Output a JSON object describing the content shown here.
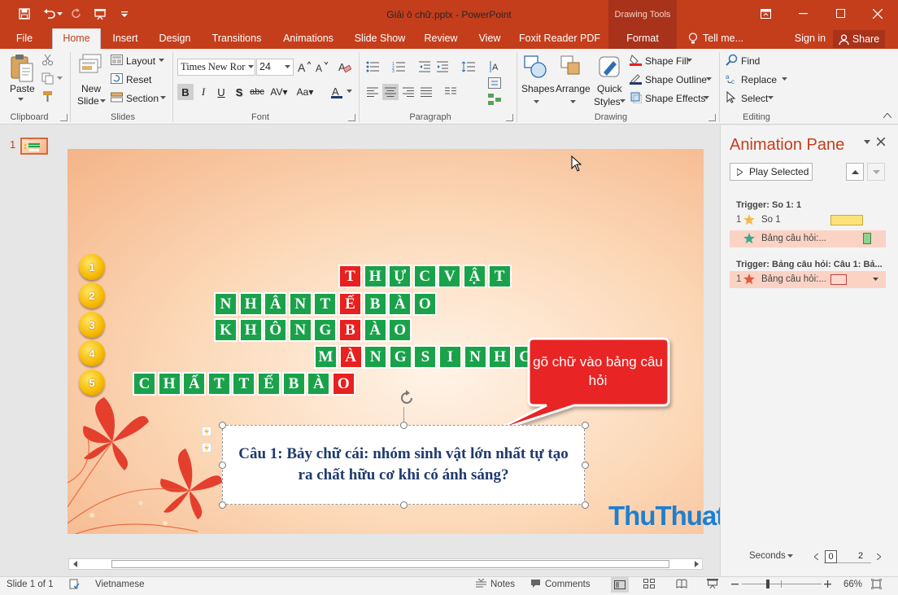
{
  "window": {
    "title": "Giải ô chữ.pptx - PowerPoint",
    "contextual_group": "Drawing Tools",
    "accent_color": "#c43e1c"
  },
  "tabs": [
    "File",
    "Home",
    "Insert",
    "Design",
    "Transitions",
    "Animations",
    "Slide Show",
    "Review",
    "View",
    "Foxit Reader PDF",
    "Format"
  ],
  "tell_me": "Tell me...",
  "sign_in": "Sign in",
  "share": "Share",
  "ribbon": {
    "clipboard": {
      "paste": "Paste",
      "label": "Clipboard"
    },
    "slides": {
      "new_slide_1": "New",
      "new_slide_2": "Slide",
      "layout": "Layout",
      "reset": "Reset",
      "section": "Section",
      "label": "Slides"
    },
    "font": {
      "name": "Times New Ror",
      "size": "24",
      "label": "Font"
    },
    "paragraph": {
      "label": "Paragraph"
    },
    "drawing": {
      "shapes": "Shapes",
      "arrange": "Arrange",
      "quick_styles_1": "Quick",
      "quick_styles_2": "Styles",
      "shape_fill": "Shape Fill",
      "shape_outline": "Shape Outline",
      "shape_effects": "Shape Effects",
      "label": "Drawing"
    },
    "editing": {
      "find": "Find",
      "replace": "Replace",
      "select": "Select",
      "label": "Editing"
    }
  },
  "thumbnails": [
    {
      "number": "1"
    }
  ],
  "slide": {
    "number_badges": [
      "1",
      "2",
      "3",
      "4",
      "5"
    ],
    "rows": [
      {
        "letters": [
          "T",
          "H",
          "Ự",
          "C",
          "V",
          "Ậ",
          "T"
        ],
        "key_index": 0
      },
      {
        "letters": [
          "N",
          "H",
          "Â",
          "N",
          "T",
          "Ế",
          "B",
          "À",
          "O"
        ],
        "key_index": 5
      },
      {
        "letters": [
          "K",
          "H",
          "Ô",
          "N",
          "G",
          "B",
          "À",
          "O"
        ],
        "key_index": 5
      },
      {
        "letters": [
          "M",
          "À",
          "N",
          "G",
          "S",
          "I",
          "N",
          "H",
          "C"
        ],
        "key_index": 1
      },
      {
        "letters": [
          "C",
          "H",
          "Ấ",
          "T",
          "T",
          "Ế",
          "B",
          "À",
          "O"
        ],
        "key_index": 8
      }
    ],
    "callout": "gõ chữ vào bảng câu hỏi",
    "question": "Câu 1: Bảy chữ cái: nhóm sinh vật lớn nhất tự tạo ra chất hữu cơ khi có ánh sáng?",
    "watermark": "ThuThuatTinHoc.vn"
  },
  "animation_pane": {
    "title": "Animation Pane",
    "play_selected": "Play Selected",
    "triggers": [
      {
        "label": "Trigger: So 1: 1",
        "items": [
          {
            "num": "1",
            "name": "So 1",
            "bar_color": "#ffe27a",
            "star_color": "#f2b84b"
          },
          {
            "num": "",
            "name": "Bảng câu hỏi:...",
            "bar_color": "#8fd18f",
            "star_color": "#3aa88a"
          }
        ]
      },
      {
        "label": "Trigger: Bảng câu hỏi: Câu 1: Bả...",
        "items": [
          {
            "num": "1",
            "name": "Bảng câu hỏi:...",
            "bar_color": "#ffd8cc",
            "star_color": "#e05a3a"
          }
        ]
      }
    ],
    "seconds": "Seconds",
    "timeline_start": "0",
    "timeline_end": "2"
  },
  "status_bar": {
    "slide_of": "Slide 1 of 1",
    "language": "Vietnamese",
    "notes": "Notes",
    "comments": "Comments",
    "zoom": "66%"
  }
}
